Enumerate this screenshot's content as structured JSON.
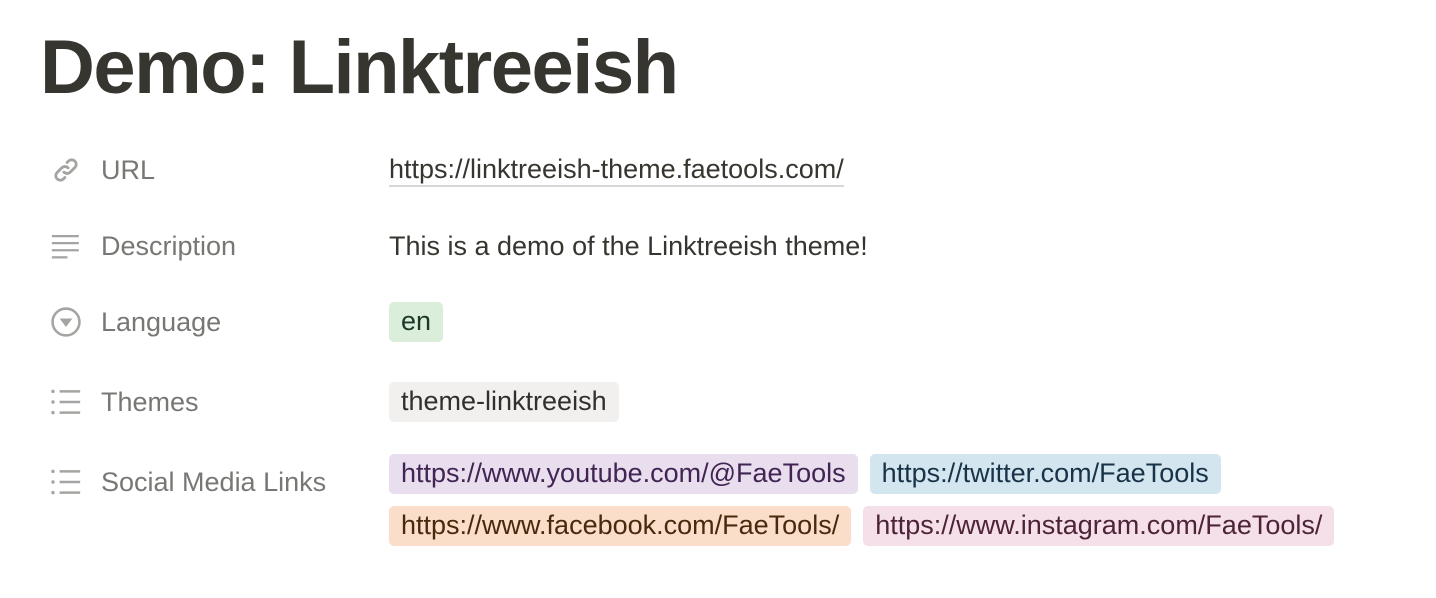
{
  "page": {
    "title": "Demo: Linktreeish"
  },
  "properties": [
    {
      "icon": "link-icon",
      "label": "URL",
      "type": "url",
      "value": "https://linktreeish-theme.faetools.com/"
    },
    {
      "icon": "text-lines-icon",
      "label": "Description",
      "type": "text",
      "value": "This is a demo of the Linktreeish theme!"
    },
    {
      "icon": "select-circle-icon",
      "label": "Language",
      "type": "select",
      "tags": [
        {
          "text": "en",
          "bg": "#dbeddb",
          "fg": "#1c3829"
        }
      ]
    },
    {
      "icon": "list-icon",
      "label": "Themes",
      "type": "multi_select",
      "tags": [
        {
          "text": "theme-linktreeish",
          "bg": "#f1f0ef",
          "fg": "#32302c"
        }
      ]
    },
    {
      "icon": "list-icon",
      "label": "Social Media Links",
      "type": "multi_select",
      "tags": [
        {
          "text": "https://www.youtube.com/@FaeTools",
          "bg": "#e8deee",
          "fg": "#412454"
        },
        {
          "text": "https://twitter.com/FaeTools",
          "bg": "#d3e5ef",
          "fg": "#183347"
        },
        {
          "text": "https://www.facebook.com/FaeTools/",
          "bg": "#fadec9",
          "fg": "#49290e"
        },
        {
          "text": "https://www.instagram.com/FaeTools/",
          "bg": "#f5e0e9",
          "fg": "#4c2337"
        }
      ]
    }
  ],
  "colors": {
    "title_text": "#37352f",
    "label_text": "#787774",
    "icon_gray": "#a5a4a1",
    "value_text": "#37352f",
    "link_underline": "#d8d7d4"
  }
}
